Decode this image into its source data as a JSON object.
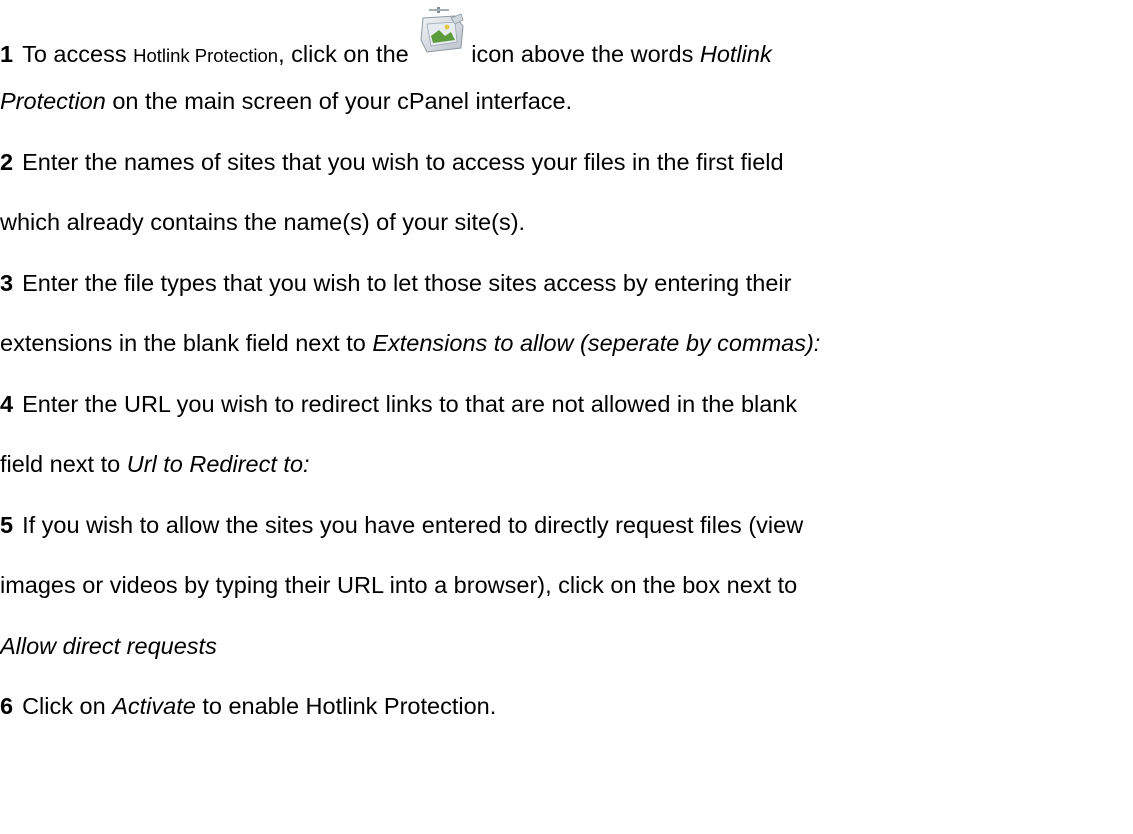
{
  "steps": [
    {
      "num": "1",
      "a": "To access ",
      "b": "Hotlink Protection",
      "c": ", click on the ",
      "d": "icon above the words ",
      "e": "Hotlink",
      "f": "Protection",
      "g": " on the main screen of your cPanel interface."
    },
    {
      "num": "2",
      "a": "Enter the names of sites that you wish to access your files in the first field",
      "b": "which already contains the name(s) of your site(s)."
    },
    {
      "num": "3",
      "a": "Enter the file types that you wish to let those sites access by entering their",
      "b": "extensions in the blank field next to ",
      "c": "Extensions to allow (seperate by commas):"
    },
    {
      "num": "4",
      "a": "Enter the URL you wish to redirect links to that are not allowed in the blank",
      "b": "field next to ",
      "c": "Url to Redirect to:"
    },
    {
      "num": "5",
      "a": "If you wish to allow the sites you have entered to directly request files (view",
      "b": "images or videos by typing their URL into a browser), click on the box next to",
      "c": "Allow direct requests"
    },
    {
      "num": "6",
      "a": "Click on ",
      "b": "Activate",
      "c": " to enable Hotlink Protection."
    }
  ],
  "icon": "hotlink-protection-icon"
}
